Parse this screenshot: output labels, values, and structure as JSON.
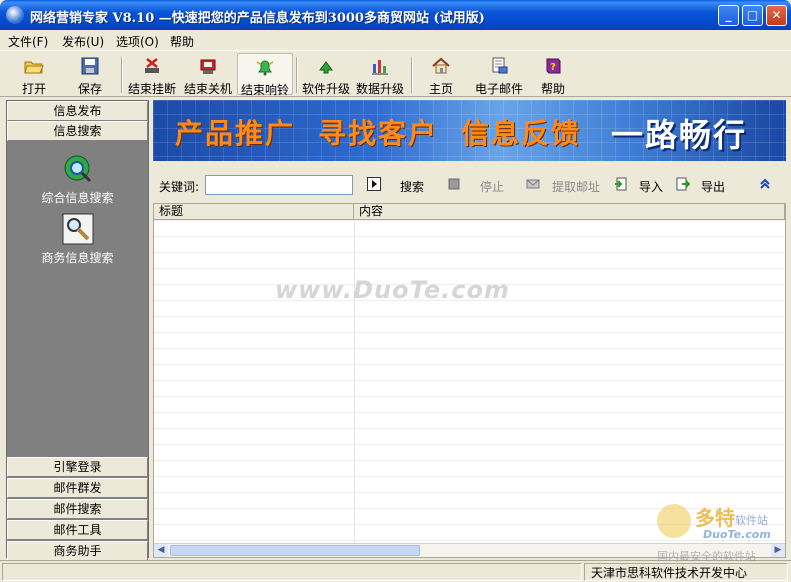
{
  "window": {
    "title": "网络营销专家 V8.10 —快速把您的产品信息发布到3000多商贸网站 (试用版)",
    "minimize": "_",
    "maximize": "□",
    "close": "✕"
  },
  "menu": [
    "文件(F)",
    "发布(U)",
    "选项(O)",
    "帮助"
  ],
  "toolbar": {
    "open": "打开",
    "save": "保存",
    "end_hangup": "结束挂断",
    "end_shutdown": "结束关机",
    "end_ring": "结束响铃",
    "software_upgrade": "软件升级",
    "data_upgrade": "数据升级",
    "home": "主页",
    "email": "电子邮件",
    "help": "帮助"
  },
  "sidebar": {
    "top_buttons": [
      "信息发布",
      "信息搜索"
    ],
    "icons": [
      "综合信息搜索",
      "商务信息搜索"
    ],
    "bottom_buttons": [
      "引擎登录",
      "邮件群发",
      "邮件搜索",
      "邮件工具",
      "商务助手"
    ]
  },
  "banner": {
    "slogans": [
      "产品推广",
      "寻找客户",
      "信息反馈",
      "一路畅行"
    ]
  },
  "search": {
    "keyword_label": "关键词:",
    "keyword_value": "",
    "search_label": "搜索",
    "stop_label": "停止",
    "extract_label": "提取邮址",
    "import_label": "导入",
    "export_label": "导出"
  },
  "table": {
    "columns": [
      "标题",
      "内容"
    ]
  },
  "watermark": "www.DuoTe.com",
  "corner_logo": {
    "big": "多特",
    "small": "软件站",
    "sub": "DuoTe.com",
    "tagline": "国内最安全的软件站"
  },
  "status": {
    "company": "天津市思科软件技术开发中心"
  }
}
